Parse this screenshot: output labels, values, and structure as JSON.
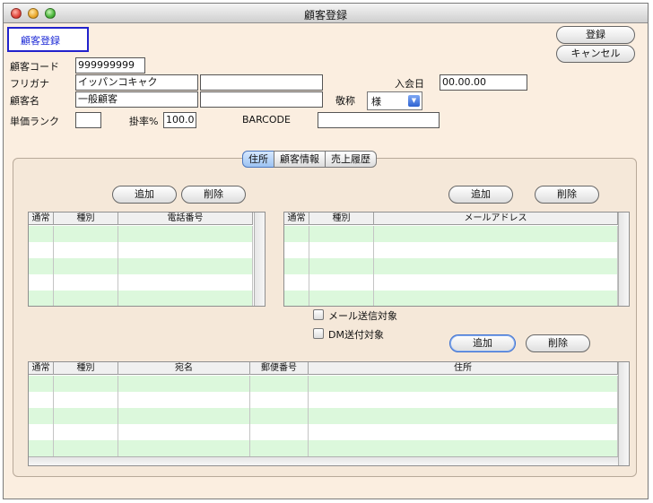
{
  "window": {
    "title": "顧客登録"
  },
  "header": {
    "badge": "顧客登録"
  },
  "actions": {
    "register": "登録",
    "cancel": "キャンセル"
  },
  "form": {
    "customer_code_label": "顧客コード",
    "customer_code": "999999999",
    "furigana_label": "フリガナ",
    "furigana": "イッパンコキャク",
    "furigana2": "",
    "name_label": "顧客名",
    "name": "一般顧客",
    "name2": "",
    "join_date_label": "入会日",
    "join_date": "00.00.00",
    "honorific_label": "敬称",
    "honorific": "様",
    "price_rank_label": "単価ランク",
    "price_rank": "",
    "rate_label": "掛率%",
    "rate": "100.0",
    "barcode_label": "BARCODE",
    "barcode": ""
  },
  "tabs": [
    {
      "label": "住所",
      "active": true
    },
    {
      "label": "顧客情報",
      "active": false
    },
    {
      "label": "売上履歴",
      "active": false
    }
  ],
  "phone_section": {
    "add": "追加",
    "delete": "削除",
    "columns": [
      "通常",
      "種別",
      "電話番号"
    ]
  },
  "email_section": {
    "add": "追加",
    "delete": "削除",
    "columns": [
      "通常",
      "種別",
      "メールアドレス"
    ],
    "mail_send_label": "メール送信対象",
    "dm_send_label": "DM送付対象"
  },
  "address_section": {
    "add": "追加",
    "delete": "削除",
    "columns": [
      "通常",
      "種別",
      "宛名",
      "郵便番号",
      "住所"
    ]
  },
  "colors": {
    "row_green": "#dcf8dc",
    "accent_blue": "#2222cc"
  }
}
